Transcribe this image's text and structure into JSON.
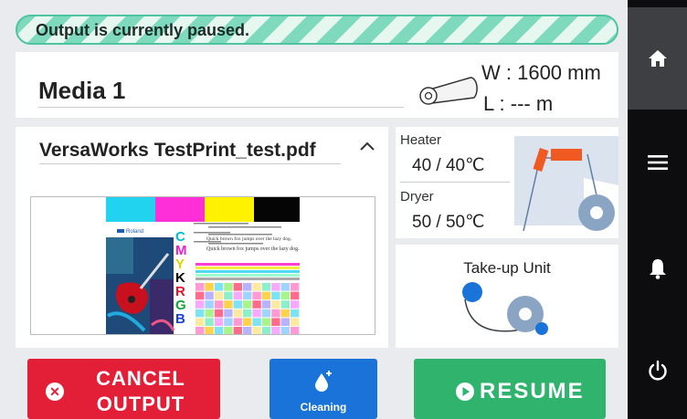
{
  "status": {
    "message": "Output is currently paused."
  },
  "media": {
    "name": "Media 1",
    "width_text": "W : 1600 mm",
    "length_text": "L  : --- m"
  },
  "job": {
    "file_name": "VersaWorks TestPrint_test.pdf",
    "preview": {
      "brand": "Roland",
      "ink_letters": [
        "C",
        "M",
        "Y",
        "K",
        "R",
        "G",
        "B"
      ],
      "sample_text": "Quick brown fox jumps over the lazy dog."
    }
  },
  "heater": {
    "label": "Heater",
    "value": "40 / 40℃"
  },
  "dryer": {
    "label": "Dryer",
    "value": "50 / 50℃"
  },
  "takeup": {
    "label": "Take-up Unit"
  },
  "buttons": {
    "cancel_line1": "CANCEL",
    "cancel_line2": "OUTPUT",
    "cleaning": "Cleaning",
    "resume": "RESUME"
  },
  "rail": {
    "items": [
      "home-icon",
      "menu-icon",
      "bell-icon",
      "power-icon"
    ]
  },
  "colors": {
    "status_green": "#4cc4a0",
    "cancel_red": "#e31e37",
    "cleaning_blue": "#1a73d9",
    "resume_green": "#2fb36d",
    "heater_orange": "#f05a22",
    "takeup_blue": "#1a73d9"
  }
}
